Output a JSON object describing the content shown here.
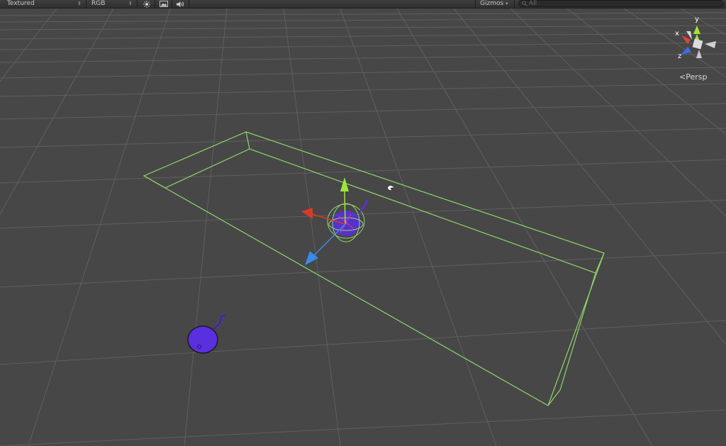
{
  "toolbar": {
    "shading_mode": "Textured",
    "render_mode": "RGB",
    "lighting_icon": "sun-icon",
    "image_icon": "image-icon",
    "audio_icon": "speaker-icon",
    "gizmos_label": "Gizmos",
    "search_placeholder": "All"
  },
  "scene_gizmo": {
    "projection_label": "Persp",
    "axis_y": "y",
    "axis_x": "x",
    "axis_z": "z",
    "colors": {
      "x": "#e8413a",
      "y": "#a4e43a",
      "z": "#3a6de8"
    }
  },
  "scene": {
    "background_color": "#474747",
    "grid_color": "#5e5e5e",
    "bounds_color": "#8ed66a",
    "object_color": "#5a2fe0",
    "handle_colors": {
      "x": "#d83a2a",
      "y": "#9ee63a",
      "z": "#3a8ae8"
    }
  }
}
